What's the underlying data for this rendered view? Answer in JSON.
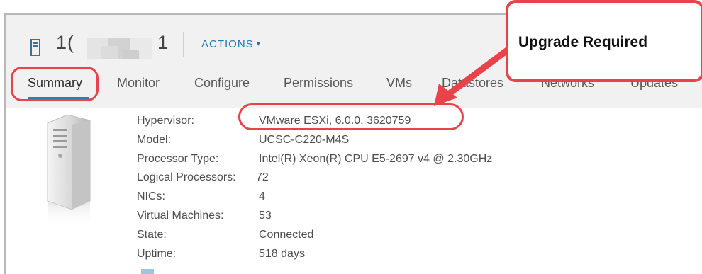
{
  "host": {
    "name_prefix": "1(",
    "name_suffix": "1",
    "actions_label": "ACTIONS",
    "actions_chevron": "▾"
  },
  "tabs": [
    {
      "label": "Summary",
      "active": true
    },
    {
      "label": "Monitor"
    },
    {
      "label": "Configure"
    },
    {
      "label": "Permissions"
    },
    {
      "label": "VMs"
    },
    {
      "label": "Datastores"
    },
    {
      "label": "Networks"
    },
    {
      "label": "Updates"
    }
  ],
  "summary": {
    "properties": [
      {
        "key": "Hypervisor:",
        "value": "VMware ESXi, 6.0.0, 3620759"
      },
      {
        "key": "Model:",
        "value": "UCSC-C220-M4S"
      },
      {
        "key": "Processor Type:",
        "value": "Intel(R) Xeon(R) CPU E5-2697 v4 @ 2.30GHz"
      },
      {
        "key": "Logical Processors:",
        "value": "72"
      },
      {
        "key": "NICs:",
        "value": "4"
      },
      {
        "key": "Virtual Machines:",
        "value": "53"
      },
      {
        "key": "State:",
        "value": "Connected"
      },
      {
        "key": "Uptime:",
        "value": "518 days"
      }
    ]
  },
  "annotation": {
    "callout_text": "Upgrade Required",
    "color": "#e8434a"
  },
  "colors": {
    "accent": "#1a7ab0",
    "tab_underline": "#2a7fb0",
    "header_bg": "#f1f1f1"
  }
}
